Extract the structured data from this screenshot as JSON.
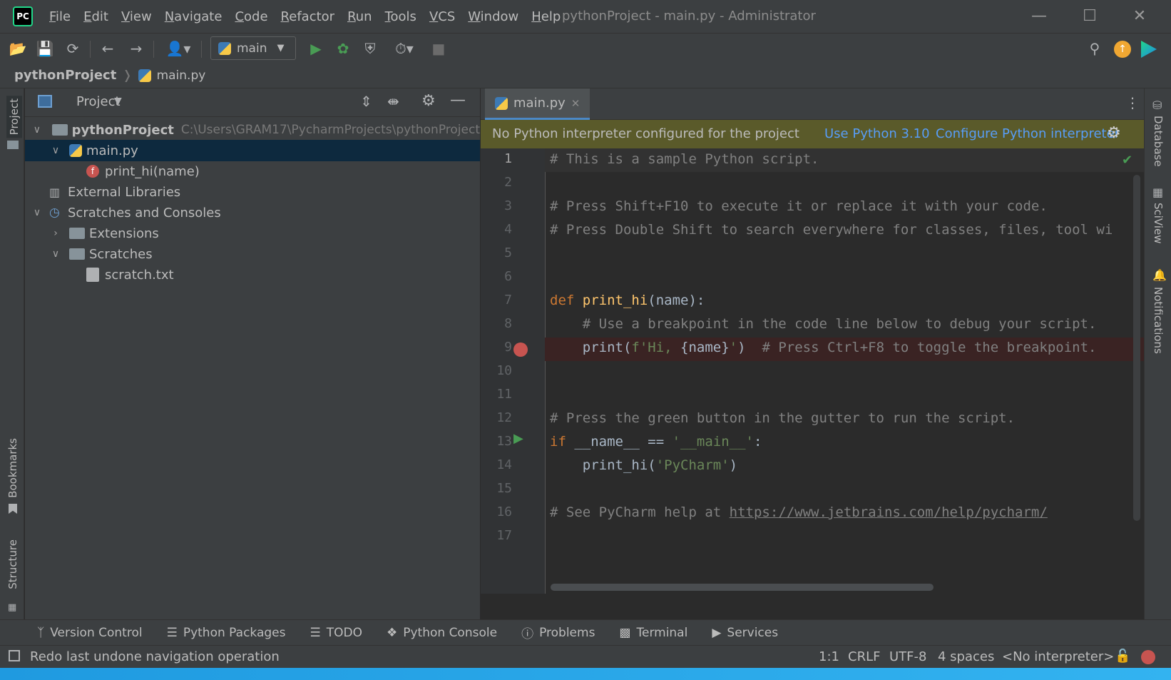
{
  "app": {
    "logo_text": "PC",
    "window_title": "pythonProject - main.py - Administrator",
    "menu": [
      "File",
      "Edit",
      "View",
      "Navigate",
      "Code",
      "Refactor",
      "Run",
      "Tools",
      "VCS",
      "Window",
      "Help"
    ]
  },
  "toolbar": {
    "run_config": "main"
  },
  "breadcrumb": {
    "project": "pythonProject",
    "file": "main.py"
  },
  "left_strip": {
    "project_tab": "Project",
    "bookmarks_tab": "Bookmarks",
    "structure_tab": "Structure"
  },
  "project_panel": {
    "title": "Project",
    "tree": [
      {
        "label": "pythonProject",
        "path": "C:\\Users\\GRAM17\\PycharmProjects\\pythonProject",
        "level": 0,
        "expanded": true
      },
      {
        "label": "main.py",
        "level": 1,
        "expanded": true,
        "selected": true
      },
      {
        "label": "print_hi(name)",
        "level": 2
      },
      {
        "label": "External Libraries",
        "level": 0
      },
      {
        "label": "Scratches and Consoles",
        "level": 0,
        "expanded": true
      },
      {
        "label": "Extensions",
        "level": 1,
        "expanded": false
      },
      {
        "label": "Scratches",
        "level": 1,
        "expanded": true
      },
      {
        "label": "scratch.txt",
        "level": 2
      }
    ]
  },
  "editor": {
    "tab_label": "main.py",
    "banner": {
      "message": "No Python interpreter configured for the project",
      "use_python": "Use Python 3.10",
      "configure": "Configure Python interpreter"
    },
    "lines": [
      "# This is a sample Python script.",
      "",
      "# Press Shift+F10 to execute it or replace it with your code.",
      "# Press Double Shift to search everywhere for classes, files, tool wi",
      "",
      "",
      "def print_hi(name):",
      "    # Use a breakpoint in the code line below to debug your script.",
      "    print(f'Hi, {name}')  # Press Ctrl+F8 to toggle the breakpoint.",
      "",
      "",
      "# Press the green button in the gutter to run the script.",
      "if __name__ == '__main__':",
      "    print_hi('PyCharm')",
      "",
      "# See PyCharm help at https://www.jetbrains.com/help/pycharm/",
      ""
    ],
    "line_numbers": [
      "1",
      "2",
      "3",
      "4",
      "5",
      "6",
      "7",
      "8",
      "9",
      "10",
      "11",
      "12",
      "13",
      "14",
      "15",
      "16",
      "17"
    ],
    "help_url": "https://www.jetbrains.com/help/pycharm/"
  },
  "right_strip": {
    "database_tab": "Database",
    "sciview_tab": "SciView",
    "notifications_tab": "Notifications"
  },
  "bottom_tools": [
    "Version Control",
    "Python Packages",
    "TODO",
    "Python Console",
    "Problems",
    "Terminal",
    "Services"
  ],
  "status": {
    "message": "Redo last undone navigation operation",
    "position": "1:1",
    "line_sep": "CRLF",
    "encoding": "UTF-8",
    "indent": "4 spaces",
    "interpreter": "<No interpreter>"
  },
  "colors": {
    "accent": "#4a88c7",
    "run_green": "#499c54",
    "breakpoint_red": "#c75450",
    "banner_bg": "#5a5a2a",
    "link_blue": "#589df6"
  }
}
